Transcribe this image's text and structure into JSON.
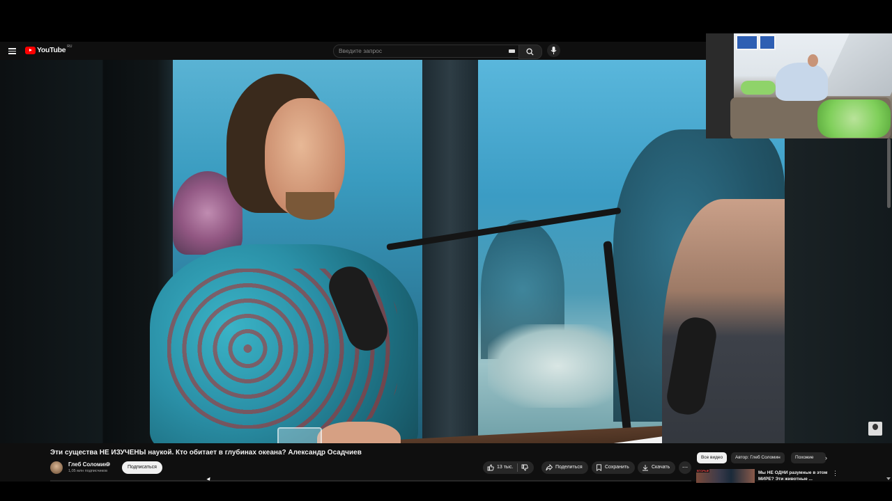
{
  "header": {
    "logo_text": "YouTube",
    "logo_region": "RU",
    "search_placeholder": "Введите запрос",
    "icons": [
      "menu-icon",
      "youtube-logo-icon",
      "keyboard-icon",
      "search-icon",
      "mic-icon"
    ]
  },
  "video": {
    "title": "Эти существа НЕ ИЗУЧЕНЫ наукой. Кто обитает в глубинах океана? Александр Осадчиев"
  },
  "channel": {
    "name": "Глеб Соломин",
    "subscribers": "1,05 млн подписчиков",
    "subscribe_label": "Подписаться"
  },
  "actions": {
    "likes": "13 тыс.",
    "share": "Поделиться",
    "save": "Сохранить",
    "download": "Скачать",
    "more": "..."
  },
  "chips": [
    "Все видео",
    "Автор: Глеб Соломин",
    "Похожие"
  ],
  "recommendation": {
    "thumb_label": "ВТОРЫЕ",
    "title": "Мы НЕ ОДНИ разумные в этом МИРЕ? Эти животные ..."
  },
  "colors": {
    "page_bg": "#0f0f0f",
    "brand_red": "#ff0000",
    "chip_active": "#f1f1f1"
  }
}
